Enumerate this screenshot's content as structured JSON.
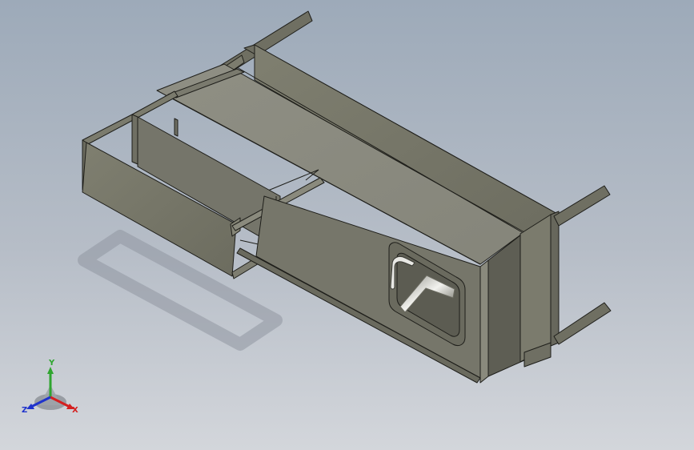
{
  "viewport": {
    "background_top": "#9daab9",
    "background_bottom": "#d3d6db"
  },
  "model": {
    "face_color": "#7b7b6b",
    "top_color": "#8c8c80",
    "edge_color": "#1e1e1a"
  },
  "triad": {
    "x_label": "X",
    "y_label": "Y",
    "z_label": "Z",
    "x_color": "#d42020",
    "y_color": "#2fa52f",
    "z_color": "#1f33cc"
  }
}
